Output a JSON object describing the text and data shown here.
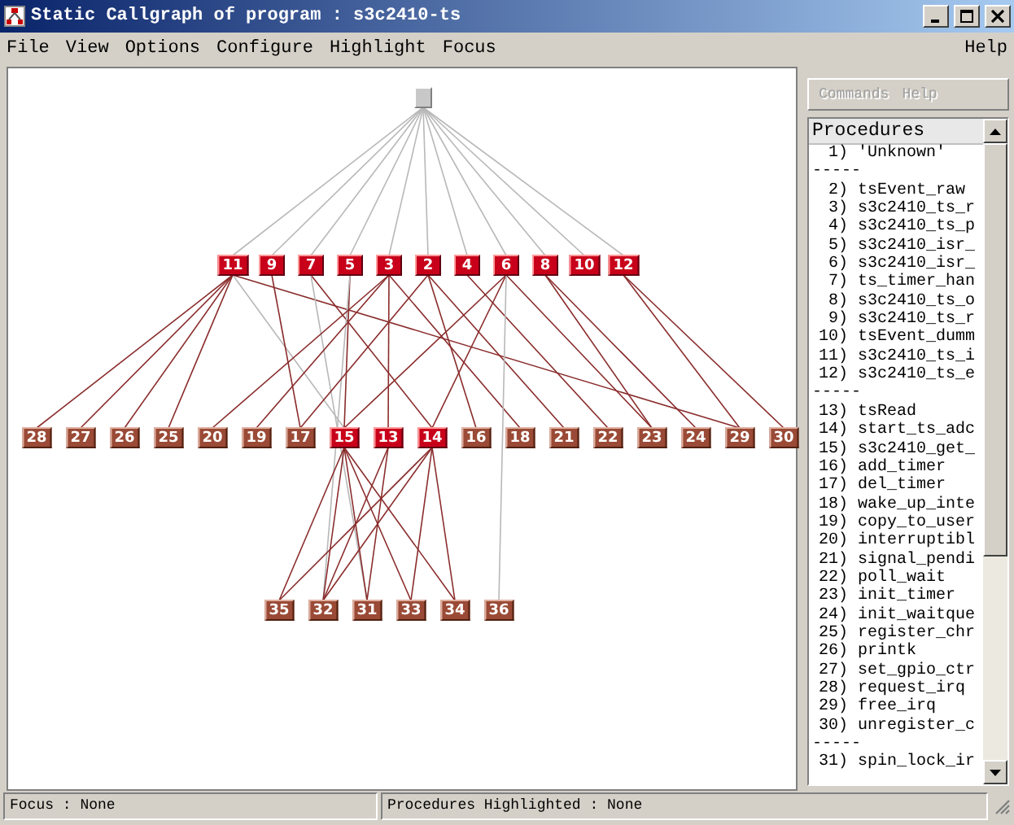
{
  "window": {
    "title": "Static Callgraph of program : s3c2410-ts"
  },
  "menu": [
    {
      "label": "File"
    },
    {
      "label": "View"
    },
    {
      "label": "Options"
    },
    {
      "label": "Configure"
    },
    {
      "label": "Highlight"
    },
    {
      "label": "Focus"
    }
  ],
  "help_menu": {
    "label": "Help"
  },
  "graph": {
    "levels": [
      [
        {
          "kind": "root"
        }
      ],
      [
        {
          "label": "11",
          "kind": "highlighted"
        },
        {
          "label": "9",
          "kind": "highlighted"
        },
        {
          "label": "7",
          "kind": "highlighted"
        },
        {
          "label": "5",
          "kind": "highlighted"
        },
        {
          "label": "3",
          "kind": "highlighted"
        },
        {
          "label": "2",
          "kind": "highlighted"
        },
        {
          "label": "4",
          "kind": "highlighted"
        },
        {
          "label": "6",
          "kind": "highlighted"
        },
        {
          "label": "8",
          "kind": "highlighted"
        },
        {
          "label": "10",
          "kind": "highlighted"
        },
        {
          "label": "12",
          "kind": "highlighted"
        }
      ],
      [
        {
          "label": "28",
          "kind": "normal"
        },
        {
          "label": "27",
          "kind": "normal"
        },
        {
          "label": "26",
          "kind": "normal"
        },
        {
          "label": "25",
          "kind": "normal"
        },
        {
          "label": "20",
          "kind": "normal"
        },
        {
          "label": "19",
          "kind": "normal"
        },
        {
          "label": "17",
          "kind": "normal"
        },
        {
          "label": "15",
          "kind": "highlighted"
        },
        {
          "label": "13",
          "kind": "highlighted"
        },
        {
          "label": "14",
          "kind": "highlighted"
        },
        {
          "label": "16",
          "kind": "normal"
        },
        {
          "label": "18",
          "kind": "normal"
        },
        {
          "label": "21",
          "kind": "normal"
        },
        {
          "label": "22",
          "kind": "normal"
        },
        {
          "label": "23",
          "kind": "normal"
        },
        {
          "label": "24",
          "kind": "normal"
        },
        {
          "label": "29",
          "kind": "normal"
        },
        {
          "label": "30",
          "kind": "normal"
        }
      ],
      [
        {
          "label": "35",
          "kind": "normal"
        },
        {
          "label": "32",
          "kind": "normal"
        },
        {
          "label": "31",
          "kind": "normal"
        },
        {
          "label": "33",
          "kind": "normal"
        },
        {
          "label": "34",
          "kind": "normal"
        },
        {
          "label": "36",
          "kind": "normal"
        }
      ]
    ]
  },
  "side_panel": {
    "tabs": [
      {
        "label": "Commands",
        "disabled": true
      },
      {
        "label": "Help",
        "disabled": true
      }
    ],
    "list": {
      "header": "Procedures",
      "items": [
        {
          "kind": "procedure",
          "text": "1) 'Unknown'"
        },
        {
          "kind": "separator",
          "text": "-----"
        },
        {
          "kind": "procedure",
          "text": "2) tsEvent_raw"
        },
        {
          "kind": "procedure",
          "text": "3) s3c2410_ts_r"
        },
        {
          "kind": "procedure",
          "text": "4) s3c2410_ts_p"
        },
        {
          "kind": "procedure",
          "text": "5) s3c2410_isr_"
        },
        {
          "kind": "procedure",
          "text": "6) s3c2410_isr_"
        },
        {
          "kind": "procedure",
          "text": "7) ts_timer_han"
        },
        {
          "kind": "procedure",
          "text": "8) s3c2410_ts_o"
        },
        {
          "kind": "procedure",
          "text": "9) s3c2410_ts_r"
        },
        {
          "kind": "procedure",
          "text": "10) tsEvent_dumm"
        },
        {
          "kind": "procedure",
          "text": "11) s3c2410_ts_i"
        },
        {
          "kind": "procedure",
          "text": "12) s3c2410_ts_e"
        },
        {
          "kind": "separator",
          "text": "-----"
        },
        {
          "kind": "procedure",
          "text": "13) tsRead"
        },
        {
          "kind": "procedure",
          "text": "14) start_ts_adc"
        },
        {
          "kind": "procedure",
          "text": "15) s3c2410_get_"
        },
        {
          "kind": "procedure",
          "text": "16) add_timer"
        },
        {
          "kind": "procedure",
          "text": "17) del_timer"
        },
        {
          "kind": "procedure",
          "text": "18) wake_up_inte"
        },
        {
          "kind": "procedure",
          "text": "19) copy_to_user"
        },
        {
          "kind": "procedure",
          "text": "20) interruptibl"
        },
        {
          "kind": "procedure",
          "text": "21) signal_pendi"
        },
        {
          "kind": "procedure",
          "text": "22) poll_wait"
        },
        {
          "kind": "procedure",
          "text": "23) init_timer"
        },
        {
          "kind": "procedure",
          "text": "24) init_waitque"
        },
        {
          "kind": "procedure",
          "text": "25) register_chr"
        },
        {
          "kind": "procedure",
          "text": "26) printk"
        },
        {
          "kind": "procedure",
          "text": "27) set_gpio_ctr"
        },
        {
          "kind": "procedure",
          "text": "28) request_irq"
        },
        {
          "kind": "procedure",
          "text": "29) free_irq"
        },
        {
          "kind": "procedure",
          "text": "30) unregister_c"
        },
        {
          "kind": "separator",
          "text": "-----"
        },
        {
          "kind": "procedure",
          "text": "31) spin_lock_ir"
        }
      ]
    }
  },
  "status_bar": {
    "focus": "Focus : None",
    "highlighted": "Procedures Highlighted : None"
  }
}
